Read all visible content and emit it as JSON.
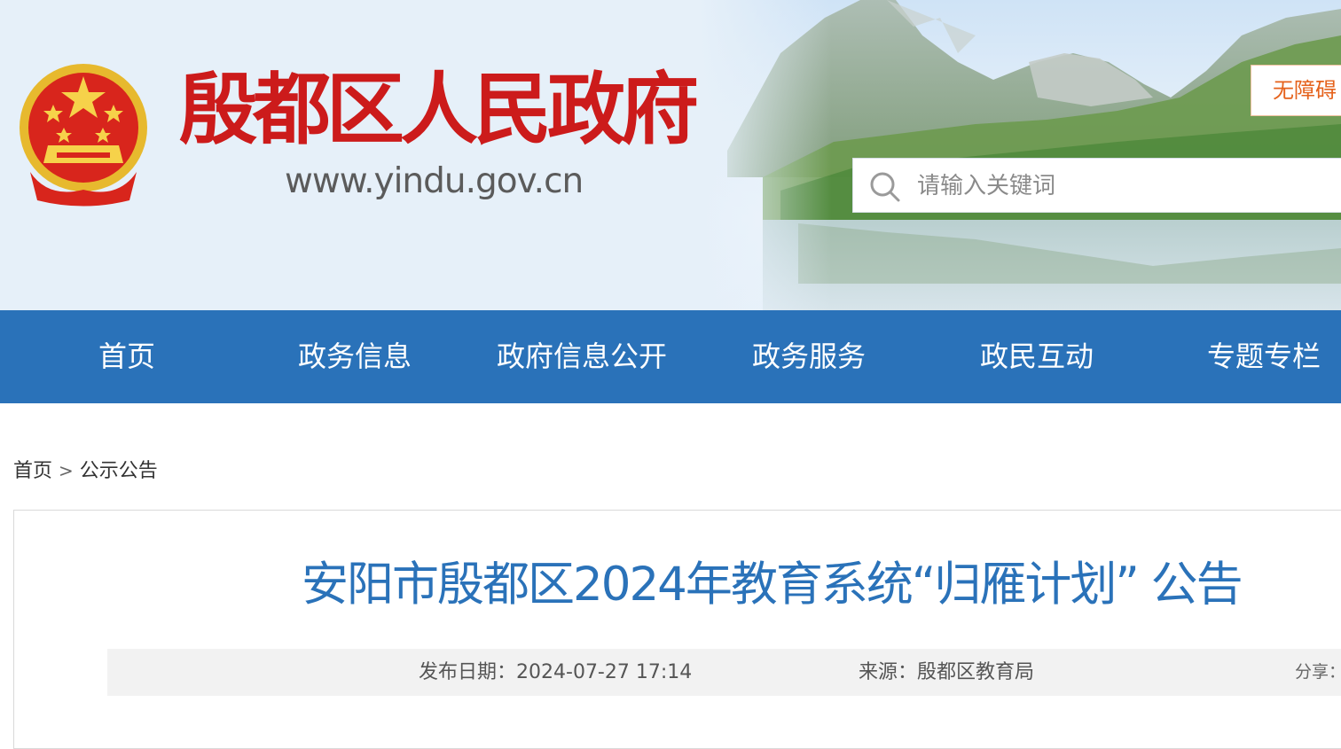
{
  "header": {
    "site_title": "殷都区人民政府",
    "site_url": "www.yindu.gov.cn",
    "accessibility_label": "无障碍",
    "search_placeholder": "请输入关键词"
  },
  "nav": {
    "items": [
      {
        "label": "首页"
      },
      {
        "label": "政务信息"
      },
      {
        "label": "政府信息公开"
      },
      {
        "label": "政务服务"
      },
      {
        "label": "政民互动"
      },
      {
        "label": "专题专栏"
      }
    ]
  },
  "breadcrumb": {
    "home": "首页",
    "separator": ">",
    "current": "公示公告"
  },
  "article": {
    "title": "安阳市殷都区2024年教育系统“归雁计划” 公告",
    "publish_label": "发布日期：",
    "publish_date": "2024-07-27 17:14",
    "source_label": "来源：",
    "source": "殷都区教育局",
    "share_label": "分享："
  },
  "colors": {
    "brand_blue": "#2a72b9",
    "title_red": "#cc1b1b",
    "accessibility_orange": "#e5621c",
    "meta_background": "#f2f2f2"
  },
  "icons": {
    "emblem": "national-emblem-icon",
    "search": "search-icon"
  }
}
